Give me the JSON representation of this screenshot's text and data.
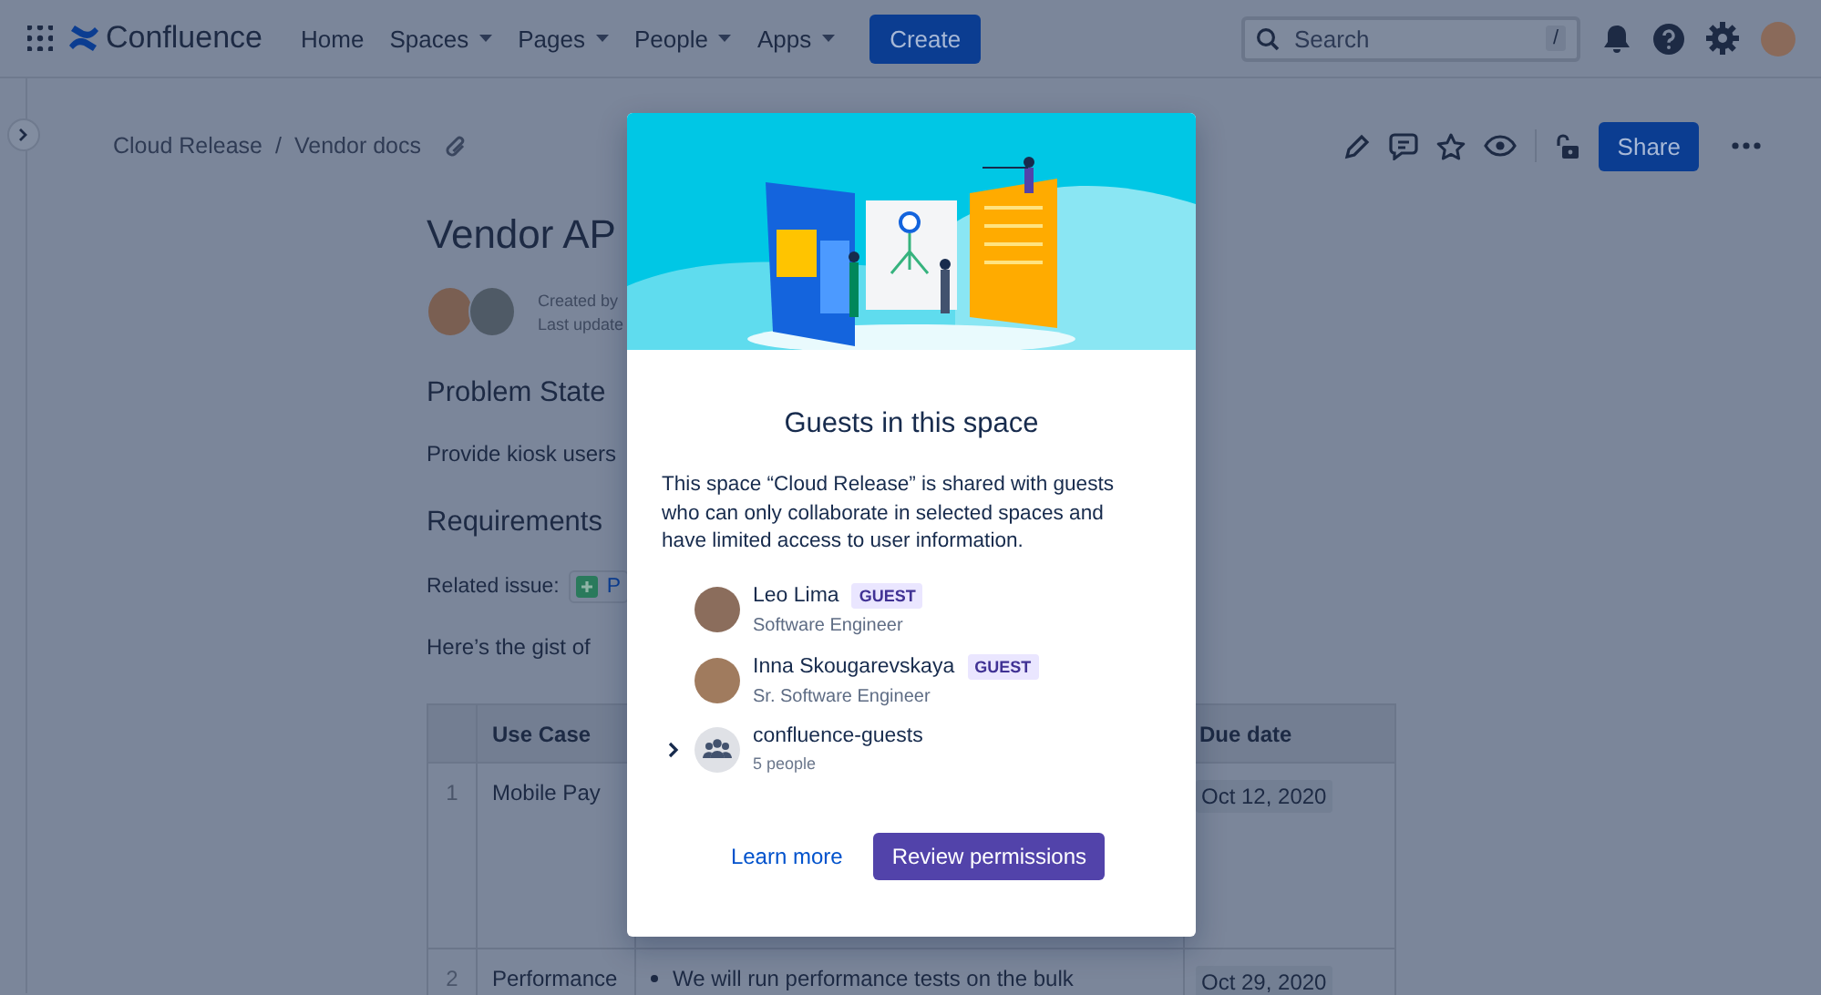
{
  "top_nav": {
    "logo": "Confluence",
    "items": [
      {
        "label": "Home",
        "dropdown": false
      },
      {
        "label": "Spaces",
        "dropdown": true
      },
      {
        "label": "Pages",
        "dropdown": true
      },
      {
        "label": "People",
        "dropdown": true
      },
      {
        "label": "Apps",
        "dropdown": true
      }
    ],
    "create_button": "Create",
    "search": {
      "placeholder": "Search",
      "shortcut": "/"
    }
  },
  "breadcrumbs": [
    "Cloud Release",
    "Vendor docs"
  ],
  "breadcrumb_separator": "/",
  "page_actions": {
    "share_button": "Share"
  },
  "page": {
    "title": "Vendor AP",
    "byline": [
      "Created by",
      "Last update"
    ],
    "sections": [
      {
        "kind": "heading",
        "text": "Problem State"
      },
      {
        "kind": "paragraph",
        "text": "Provide kiosk users"
      },
      {
        "kind": "heading",
        "text": "Requirements"
      },
      {
        "kind": "issue",
        "text": "Related issue:",
        "chip": "P"
      },
      {
        "kind": "paragraph",
        "text": "Here’s the gist of"
      }
    ],
    "table": {
      "columns": [
        "Use Case",
        "Due date"
      ],
      "rows": [
        {
          "number": "1",
          "use_case": "Mobile Pay",
          "due_date": "Oct 12, 2020"
        },
        {
          "number": "2",
          "use_case": "Performance",
          "column_3": "We will run performance tests on the bulk",
          "due_date": "Oct 29, 2020"
        }
      ]
    }
  },
  "modal": {
    "title": "Guests in this space",
    "description": "This space “Cloud Release” is shared with guests who can only collaborate in selected spaces and have limited access to user information.",
    "members": [
      {
        "kind": "person",
        "name": "Leo Lima",
        "badge": "GUEST",
        "subtitle": "Software Engineer"
      },
      {
        "kind": "person",
        "name": "Inna Skougarevskaya",
        "badge": "GUEST",
        "subtitle": "Sr. Software Engineer"
      },
      {
        "kind": "group",
        "name": "confluence-guests",
        "subtitle": "5 people",
        "expanded": false
      }
    ],
    "link": "Learn more",
    "primary_button": "Review permissions"
  }
}
